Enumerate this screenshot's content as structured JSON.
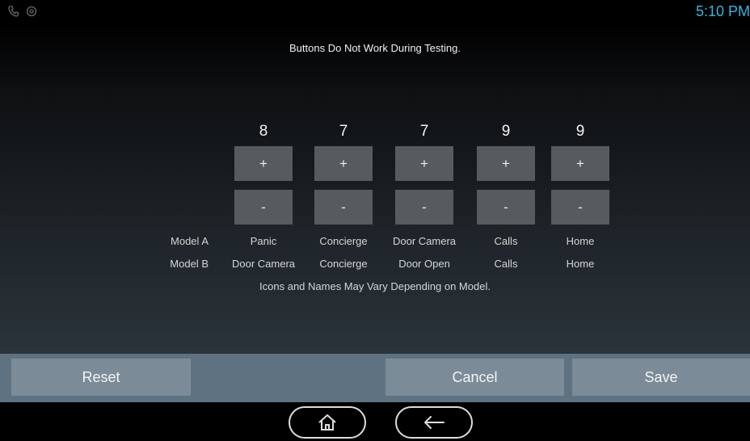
{
  "status_bar": {
    "time": "5:10 PM",
    "icons": [
      "phone-icon",
      "camera-icon"
    ]
  },
  "notice": "Buttons Do Not Work During Testing.",
  "columns": [
    {
      "level": "8",
      "plus": "+",
      "minus": "-",
      "model_a": "Panic",
      "model_b": "Door Camera"
    },
    {
      "level": "7",
      "plus": "+",
      "minus": "-",
      "model_a": "Concierge",
      "model_b": "Concierge"
    },
    {
      "level": "7",
      "plus": "+",
      "minus": "-",
      "model_a": "Door Camera",
      "model_b": "Door Open"
    },
    {
      "level": "9",
      "plus": "+",
      "minus": "-",
      "model_a": "Calls",
      "model_b": "Calls"
    },
    {
      "level": "9",
      "plus": "+",
      "minus": "-",
      "model_a": "Home",
      "model_b": "Home"
    }
  ],
  "model_labels": {
    "a": "Model A",
    "b": "Model B"
  },
  "caption": "Icons and Names May Vary Depending on Model.",
  "actions": {
    "reset": "Reset",
    "cancel": "Cancel",
    "save": "Save"
  },
  "nav": {
    "home": "home-icon",
    "back": "back-arrow-icon"
  },
  "colors": {
    "clock": "#33b5e5",
    "action_bar": "#5e7282",
    "action_button": "#7b8c98",
    "level_button": "#575b5f"
  }
}
